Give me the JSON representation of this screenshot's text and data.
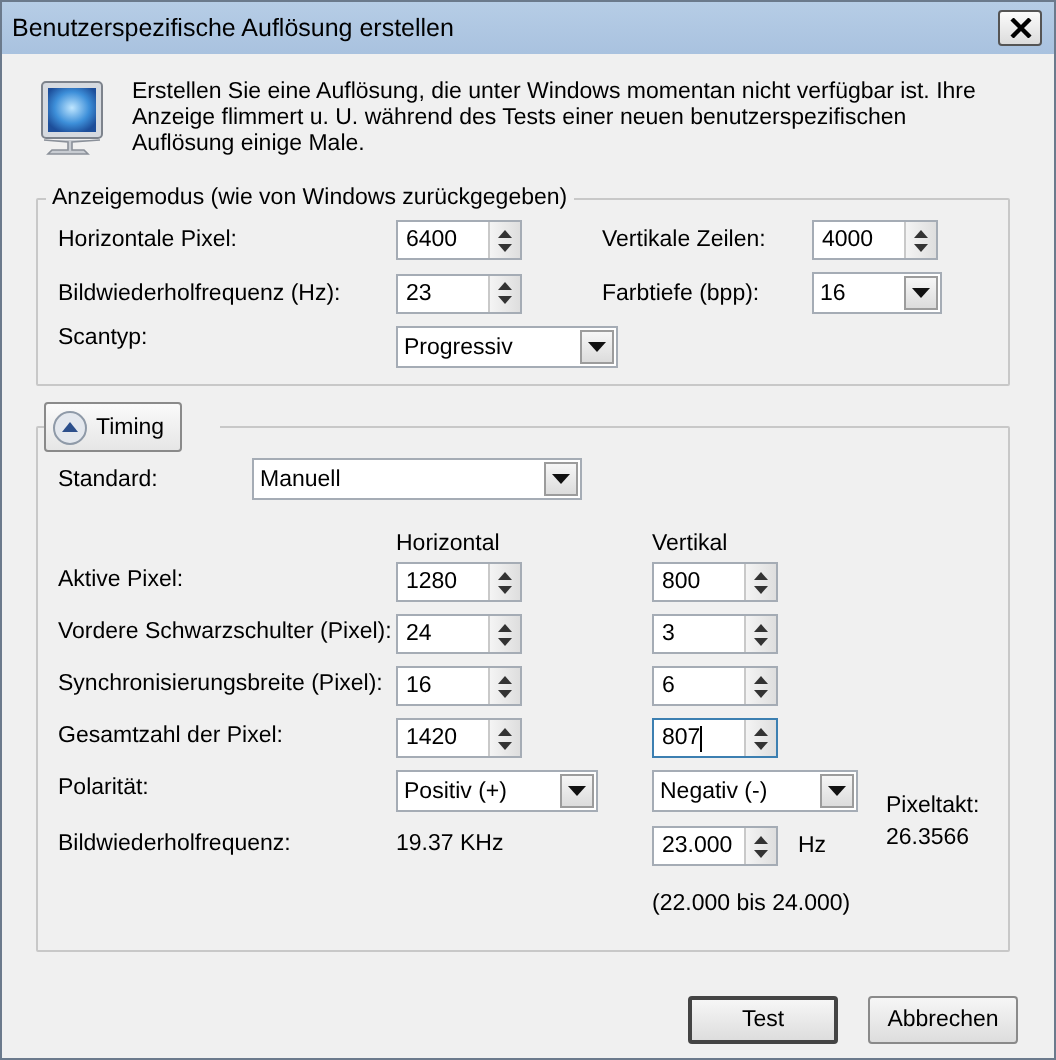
{
  "window": {
    "title": "Benutzerspezifische Auflösung erstellen"
  },
  "intro": "Erstellen Sie eine Auflösung, die unter Windows momentan nicht verfügbar ist. Ihre Anzeige flimmert u. U. während des Tests einer neuen benutzerspezifischen Auflösung einige Male.",
  "display_mode": {
    "legend": "Anzeigemodus (wie von Windows zurückgegeben)",
    "fields": [
      {
        "label": "Horizontale Pixel:",
        "kind": "spin",
        "value": "6400"
      },
      {
        "label": "Vertikale Zeilen:",
        "kind": "spin",
        "value": "4000"
      },
      {
        "label": "Bildwiederholfrequenz (Hz):",
        "kind": "spin",
        "value": "23"
      },
      {
        "label": "Farbtiefe (bpp):",
        "kind": "combo",
        "value": "16"
      },
      {
        "label": "Scantyp:",
        "kind": "combo",
        "value": "Progressiv"
      }
    ]
  },
  "timing": {
    "toggle": {
      "label": "Timing",
      "expanded": true
    },
    "standard": {
      "label": "Standard:",
      "value": "Manuell"
    },
    "columns": [
      "Horizontal",
      "Vertikal"
    ],
    "rows": [
      {
        "label": "Aktive Pixel:",
        "horizontal": {
          "kind": "spin",
          "value": "1280",
          "focused": false
        },
        "vertical": {
          "kind": "spin",
          "value": "800",
          "focused": false
        }
      },
      {
        "label": "Vordere Schwarzschulter (Pixel):",
        "horizontal": {
          "kind": "spin",
          "value": "24",
          "focused": false
        },
        "vertical": {
          "kind": "spin",
          "value": "3",
          "focused": false
        }
      },
      {
        "label": "Synchronisierungsbreite (Pixel):",
        "horizontal": {
          "kind": "spin",
          "value": "16",
          "focused": false
        },
        "vertical": {
          "kind": "spin",
          "value": "6",
          "focused": false
        }
      },
      {
        "label": "Gesamtzahl der Pixel:",
        "horizontal": {
          "kind": "spin",
          "value": "1420",
          "focused": false
        },
        "vertical": {
          "kind": "spin",
          "value": "807",
          "focused": true
        }
      },
      {
        "label": "Polarität:",
        "horizontal": {
          "kind": "combo",
          "value": "Positiv (+)"
        },
        "vertical": {
          "kind": "combo",
          "value": "Negativ (-)"
        }
      },
      {
        "label": "Bildwiederholfrequenz:",
        "horizontal": {
          "kind": "text",
          "value": "19.37 KHz"
        },
        "vertical": {
          "kind": "spin",
          "value": "23.000",
          "focused": false,
          "unit": "Hz",
          "range": "(22.000 bis 24.000)"
        },
        "extra": {
          "label": "Pixeltakt:",
          "value": "26.3566"
        }
      }
    ]
  },
  "buttons": [
    {
      "label": "Test",
      "default": true
    },
    {
      "label": "Abbrechen",
      "default": false
    }
  ]
}
